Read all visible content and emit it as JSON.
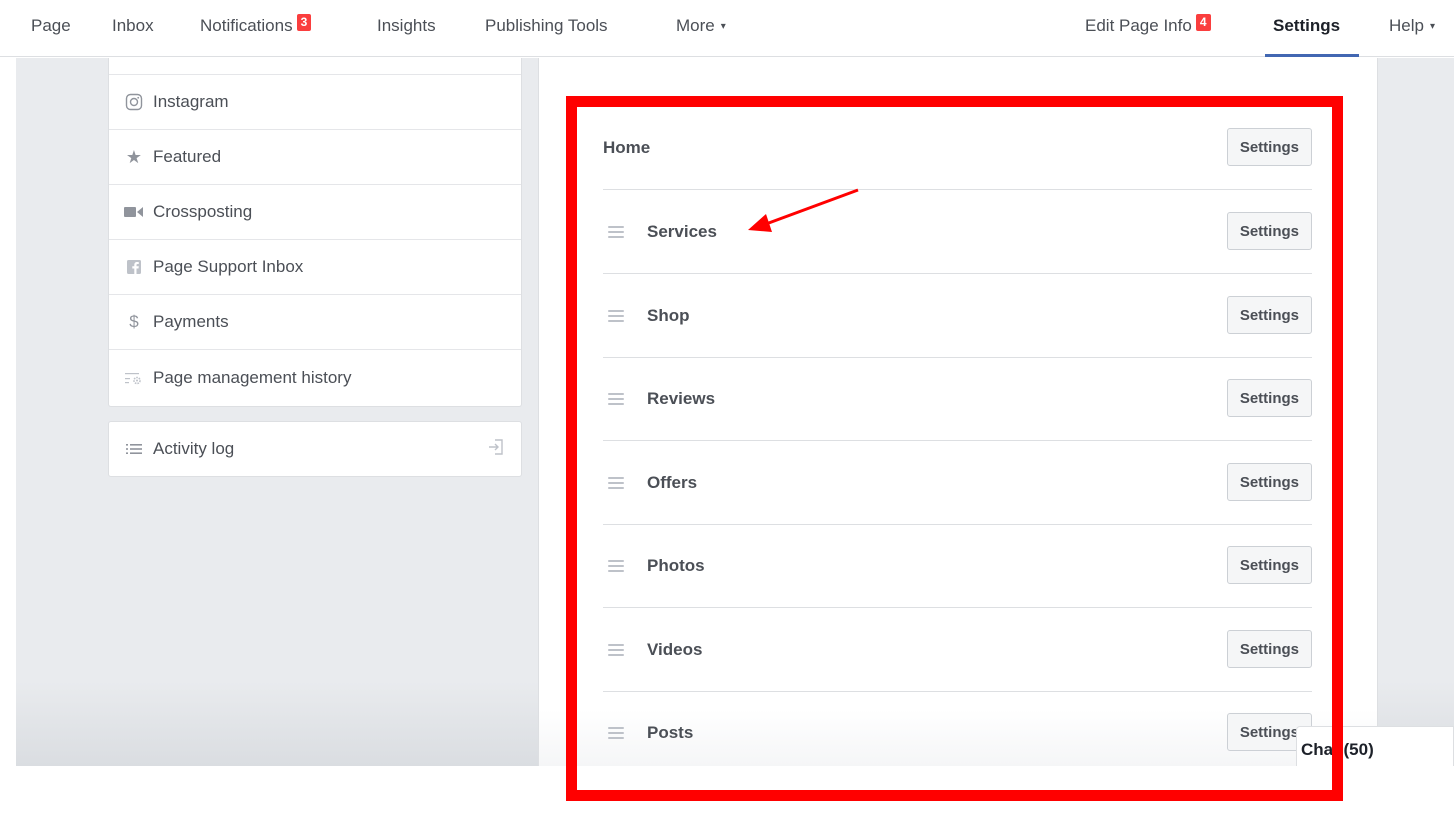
{
  "topnav": {
    "items": [
      {
        "label": "Page"
      },
      {
        "label": "Inbox"
      },
      {
        "label": "Notifications",
        "badge": "3"
      },
      {
        "label": "Insights"
      },
      {
        "label": "Publishing Tools"
      },
      {
        "label": "More",
        "dropdown": "▾"
      }
    ],
    "right_items": [
      {
        "label": "Edit Page Info",
        "badge": "4"
      },
      {
        "label": "Settings",
        "active": true
      },
      {
        "label": "Help",
        "dropdown": "▾"
      }
    ],
    "accent_color": "#4267b2",
    "badge_color": "#fa3e3e"
  },
  "sidebar": {
    "items": [
      {
        "label": "Instagram",
        "icon": "instagram-icon"
      },
      {
        "label": "Featured",
        "icon": "star-icon"
      },
      {
        "label": "Crossposting",
        "icon": "video-camera-icon"
      },
      {
        "label": "Page Support Inbox",
        "icon": "facebook-icon"
      },
      {
        "label": "Payments",
        "icon": "dollar-icon"
      },
      {
        "label": "Page management history",
        "icon": "history-gear-icon"
      }
    ],
    "activity_log": {
      "label": "Activity log",
      "icon": "list-icon",
      "action_icon": "export-icon"
    }
  },
  "tabs": {
    "button_label": "Settings",
    "items": [
      {
        "label": "Home",
        "draggable": false
      },
      {
        "label": "Services",
        "draggable": true
      },
      {
        "label": "Shop",
        "draggable": true
      },
      {
        "label": "Reviews",
        "draggable": true
      },
      {
        "label": "Offers",
        "draggable": true
      },
      {
        "label": "Photos",
        "draggable": true
      },
      {
        "label": "Videos",
        "draggable": true
      },
      {
        "label": "Posts",
        "draggable": true
      }
    ]
  },
  "chat": {
    "label": "Chat (50)"
  },
  "annotation": {
    "color": "#ff0000",
    "highlight_target": "Services"
  }
}
